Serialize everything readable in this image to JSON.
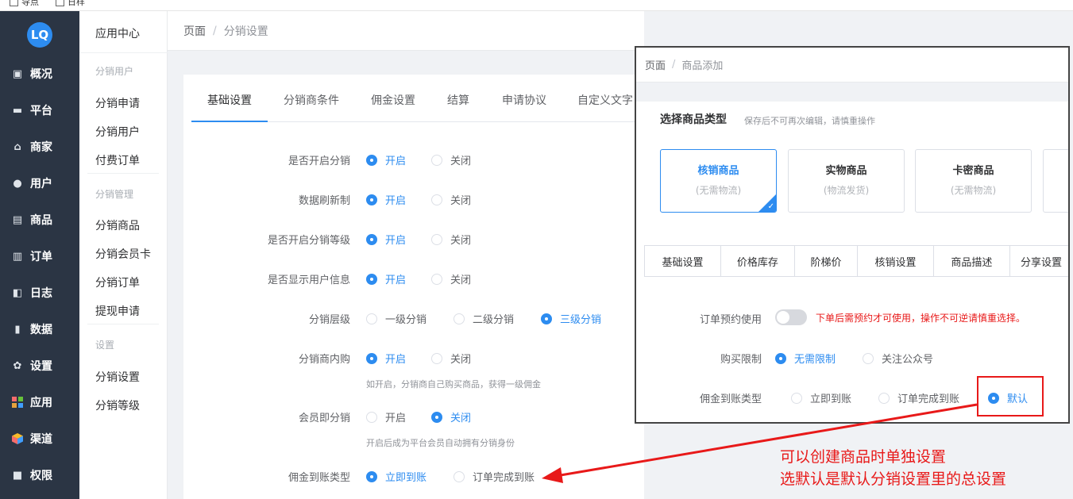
{
  "top_checkboxes": [
    "导点",
    "日样"
  ],
  "sidebar": {
    "logo": "LQ",
    "items": [
      {
        "label": "概况",
        "icon": "dashboard-icon"
      },
      {
        "label": "平台",
        "icon": "monitor-icon"
      },
      {
        "label": "商家",
        "icon": "store-icon"
      },
      {
        "label": "用户",
        "icon": "user-icon"
      },
      {
        "label": "商品",
        "icon": "goods-icon"
      },
      {
        "label": "订单",
        "icon": "order-icon"
      },
      {
        "label": "日志",
        "icon": "log-icon"
      },
      {
        "label": "数据",
        "icon": "chart-icon"
      },
      {
        "label": "设置",
        "icon": "gear-icon"
      },
      {
        "label": "应用",
        "icon": "apps-icon"
      },
      {
        "label": "渠道",
        "icon": "cube-icon"
      },
      {
        "label": "权限",
        "icon": "lock-icon"
      }
    ]
  },
  "subnav": {
    "title": "应用中心",
    "groups": [
      {
        "name": "分销用户",
        "links": [
          "分销申请",
          "分销用户",
          "付费订单"
        ]
      },
      {
        "name": "分销管理",
        "links": [
          "分销商品",
          "分销会员卡",
          "分销订单",
          "提现申请"
        ]
      },
      {
        "name": "设置",
        "links": [
          "分销设置",
          "分销等级"
        ]
      }
    ]
  },
  "breadcrumb": {
    "root": "页面",
    "sep": "/",
    "current": "分销设置"
  },
  "tabs": [
    "基础设置",
    "分销商条件",
    "佣金设置",
    "结算",
    "申请协议",
    "自定义文字"
  ],
  "form": [
    {
      "label": "是否开启分销",
      "options": [
        "开启",
        "关闭"
      ]
    },
    {
      "label": "数据刷新制",
      "options": [
        "开启",
        "关闭"
      ]
    },
    {
      "label": "是否开启分销等级",
      "options": [
        "开启",
        "关闭"
      ]
    },
    {
      "label": "是否显示用户信息",
      "options": [
        "开启",
        "关闭"
      ]
    },
    {
      "label": "分销层级",
      "options": [
        "一级分销",
        "二级分销",
        "三级分销"
      ]
    },
    {
      "label": "分销商内购",
      "options": [
        "开启",
        "关闭"
      ],
      "hint": "如开启，分销商自己购买商品，获得一级佣金"
    },
    {
      "label": "会员即分销",
      "options": [
        "开启",
        "关闭"
      ],
      "hint": "开启后成为平台会员自动拥有分销身份"
    },
    {
      "label": "佣金到账类型",
      "options": [
        "立即到账",
        "订单完成到账"
      ]
    }
  ],
  "overlay": {
    "breadcrumb": {
      "root": "页面",
      "sep": "/",
      "current": "商品添加"
    },
    "section_title": "选择商品类型",
    "section_note": "保存后不可再次编辑，请慎重操作",
    "goods_types": [
      {
        "title": "核销商品",
        "sub": "(无需物流)"
      },
      {
        "title": "实物商品",
        "sub": "(物流发货)"
      },
      {
        "title": "卡密商品",
        "sub": "(无需物流)"
      }
    ],
    "tabs": [
      "基础设置",
      "价格库存",
      "阶梯价",
      "核销设置",
      "商品描述",
      "分享设置"
    ],
    "reserve_label": "订单预约使用",
    "reserve_warning": "下单后需预约才可使用，操作不可逆请慎重选择。",
    "limit_label": "购买限制",
    "limit_options": [
      "无需限制",
      "关注公众号"
    ],
    "commission_label": "佣金到账类型",
    "commission_options": [
      "立即到账",
      "订单完成到账",
      "默认"
    ]
  },
  "annotation": {
    "line1": "可以创建商品时单独设置",
    "line2": "选默认是默认分销设置里的总设置"
  },
  "colors": {
    "accent": "#2d8cf0",
    "sidebar": "#2b3544",
    "annotation_red": "#e81919"
  }
}
